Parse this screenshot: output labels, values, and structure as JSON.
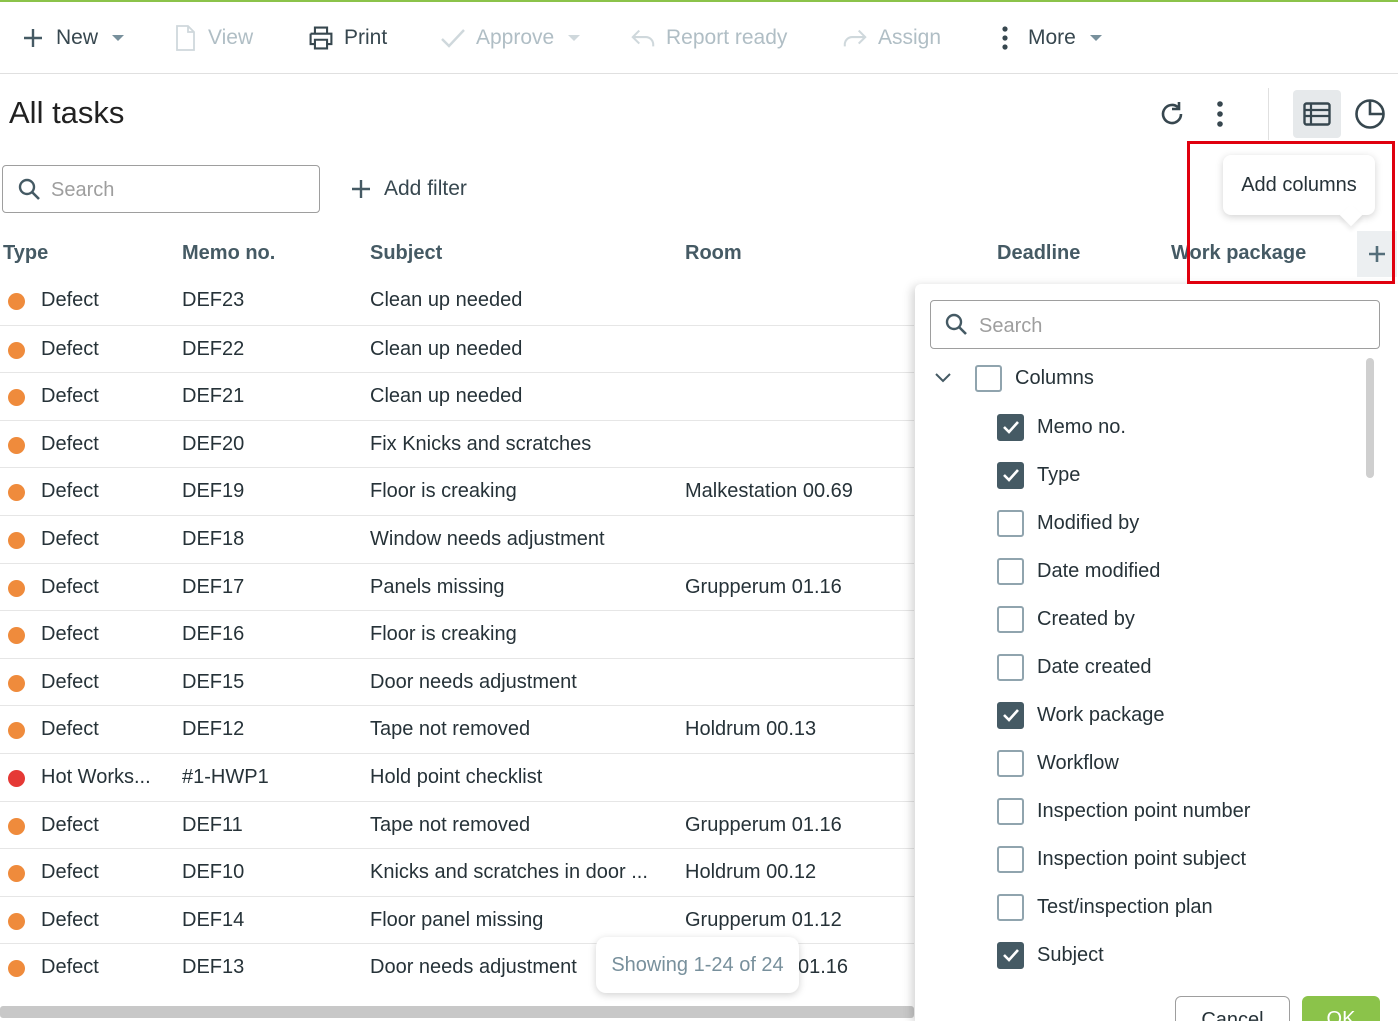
{
  "toolbar": {
    "new": "New",
    "view": "View",
    "print": "Print",
    "approve": "Approve",
    "report_ready": "Report ready",
    "assign": "Assign",
    "more": "More"
  },
  "page": {
    "title": "All tasks"
  },
  "search": {
    "placeholder": "Search"
  },
  "filter": {
    "add_label": "Add filter"
  },
  "table": {
    "headers": {
      "type": "Type",
      "memo": "Memo no.",
      "subject": "Subject",
      "room": "Room",
      "deadline": "Deadline",
      "work_package": "Work package"
    },
    "rows": [
      {
        "status_color": "#ef8b3c",
        "type": "Defect",
        "memo": "DEF23",
        "subject": "Clean up needed",
        "room": ""
      },
      {
        "status_color": "#ef8b3c",
        "type": "Defect",
        "memo": "DEF22",
        "subject": "Clean up needed",
        "room": ""
      },
      {
        "status_color": "#ef8b3c",
        "type": "Defect",
        "memo": "DEF21",
        "subject": "Clean up needed",
        "room": ""
      },
      {
        "status_color": "#ef8b3c",
        "type": "Defect",
        "memo": "DEF20",
        "subject": "Fix Knicks and scratches",
        "room": ""
      },
      {
        "status_color": "#ef8b3c",
        "type": "Defect",
        "memo": "DEF19",
        "subject": "Floor is creaking",
        "room": "Malkestation 00.69"
      },
      {
        "status_color": "#ef8b3c",
        "type": "Defect",
        "memo": "DEF18",
        "subject": "Window needs adjustment",
        "room": ""
      },
      {
        "status_color": "#ef8b3c",
        "type": "Defect",
        "memo": "DEF17",
        "subject": "Panels missing",
        "room": "Grupperum 01.16"
      },
      {
        "status_color": "#ef8b3c",
        "type": "Defect",
        "memo": "DEF16",
        "subject": "Floor is creaking",
        "room": ""
      },
      {
        "status_color": "#ef8b3c",
        "type": "Defect",
        "memo": "DEF15",
        "subject": "Door needs adjustment",
        "room": ""
      },
      {
        "status_color": "#ef8b3c",
        "type": "Defect",
        "memo": "DEF12",
        "subject": "Tape not removed",
        "room": "Holdrum 00.13"
      },
      {
        "status_color": "#e53935",
        "type": "Hot Works...",
        "memo": "#1-HWP1",
        "subject": "Hold point checklist",
        "room": ""
      },
      {
        "status_color": "#ef8b3c",
        "type": "Defect",
        "memo": "DEF11",
        "subject": "Tape not removed",
        "room": "Grupperum 01.16"
      },
      {
        "status_color": "#ef8b3c",
        "type": "Defect",
        "memo": "DEF10",
        "subject": "Knicks and scratches in door ...",
        "room": "Holdrum 00.12"
      },
      {
        "status_color": "#ef8b3c",
        "type": "Defect",
        "memo": "DEF14",
        "subject": "Floor panel missing",
        "room": "Grupperum 01.12"
      },
      {
        "status_color": "#ef8b3c",
        "type": "Defect",
        "memo": "DEF13",
        "subject": "Door needs adjustment",
        "room": "01.16"
      }
    ]
  },
  "tooltip": {
    "text": "Add columns"
  },
  "columns_panel": {
    "search_placeholder": "Search",
    "group_label": "Columns",
    "group_checked": false,
    "options": [
      {
        "label": "Memo no.",
        "checked": true
      },
      {
        "label": "Type",
        "checked": true
      },
      {
        "label": "Modified by",
        "checked": false
      },
      {
        "label": "Date modified",
        "checked": false
      },
      {
        "label": "Created by",
        "checked": false
      },
      {
        "label": "Date created",
        "checked": false
      },
      {
        "label": "Work package",
        "checked": true
      },
      {
        "label": "Workflow",
        "checked": false
      },
      {
        "label": "Inspection point number",
        "checked": false
      },
      {
        "label": "Inspection point subject",
        "checked": false
      },
      {
        "label": "Test/inspection plan",
        "checked": false
      },
      {
        "label": "Subject",
        "checked": true
      }
    ],
    "cancel": "Cancel",
    "ok": "OK"
  },
  "footer": {
    "showing": "Showing 1-24 of 24"
  },
  "colors": {
    "accent": "#8bc34a",
    "checkbox": "#455a64",
    "highlight": "#e0000e"
  }
}
